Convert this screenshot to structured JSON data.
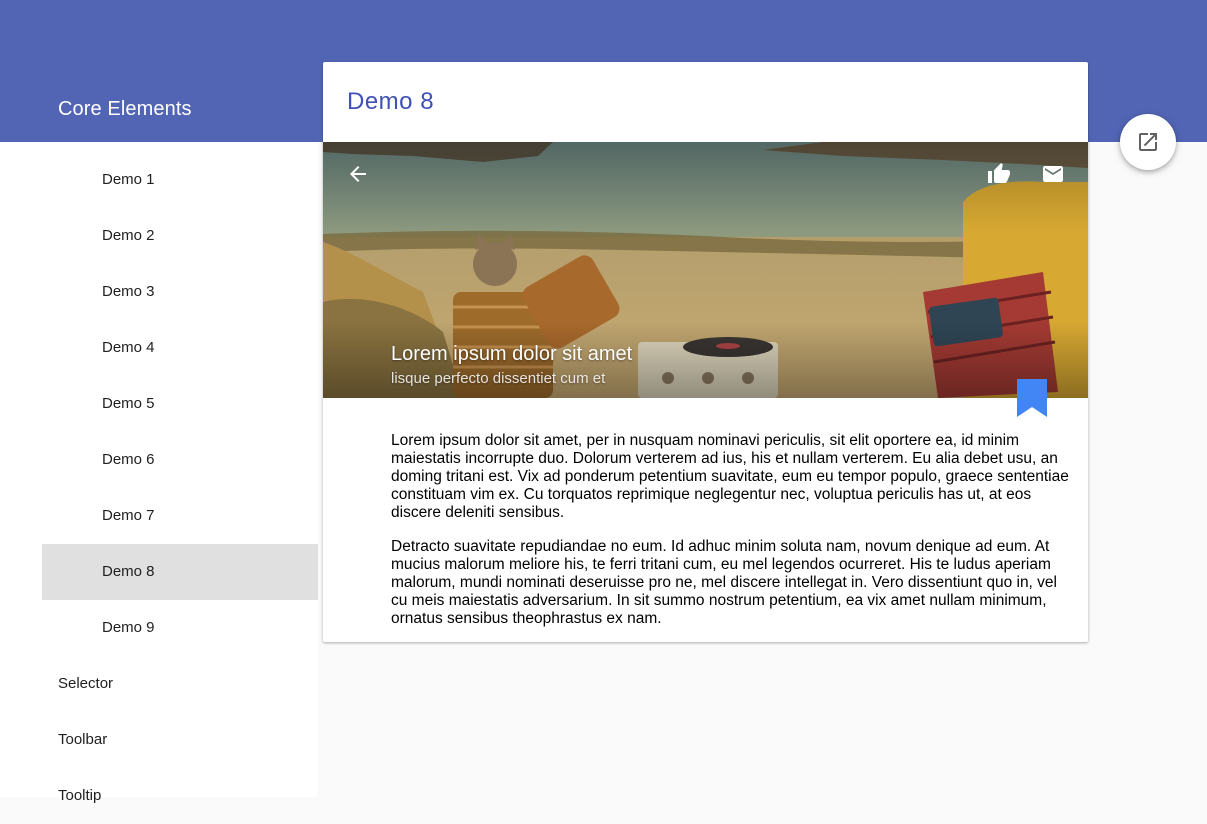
{
  "app": {
    "title": "Core Elements"
  },
  "sidebar": {
    "items": [
      {
        "label": "Demo 1"
      },
      {
        "label": "Demo 2"
      },
      {
        "label": "Demo 3"
      },
      {
        "label": "Demo 4"
      },
      {
        "label": "Demo 5"
      },
      {
        "label": "Demo 6"
      },
      {
        "label": "Demo 7"
      },
      {
        "label": "Demo 8",
        "selected": true
      },
      {
        "label": "Demo 9"
      },
      {
        "label": "Selector"
      },
      {
        "label": "Toolbar"
      },
      {
        "label": "Tooltip"
      }
    ]
  },
  "card": {
    "title": "Demo 8",
    "hero": {
      "heading": "Lorem ipsum dolor sit amet",
      "subheading": "lisque perfecto dissentiet cum et"
    },
    "paragraphs": [
      "Lorem ipsum dolor sit amet, per in nusquam nominavi periculis, sit elit oportere ea, id minim maiestatis incorrupte duo. Dolorum verterem ad ius, his et nullam verterem. Eu alia debet usu, an doming tritani est. Vix ad ponderum petentium suavitate, eum eu tempor populo, graece sententiae constituam vim ex. Cu torquatos reprimique neglegentur nec, voluptua periculis has ut, at eos discere deleniti sensibus.",
      "Detracto suavitate repudiandae no eum. Id adhuc minim soluta nam, novum denique ad eum. At mucius malorum meliore his, te ferri tritani cum, eu mel legendos ocurreret. His te ludus aperiam malorum, mundi nominati deseruisse pro ne, mel discere intellegat in. Vero dissentiunt quo in, vel cu meis maiestatis adversarium. In sit summo nostrum petentium, ea vix amet nullam minimum, ornatus sensibus theophrastus ex nam."
    ]
  },
  "icons": {
    "back": "arrow-back-icon",
    "like": "thumb-up-icon",
    "mail": "mail-icon",
    "bookmark": "bookmark-icon",
    "fab": "open-in-new-icon"
  },
  "colors": {
    "header": "#5265b5",
    "title_accent": "#3f51b5",
    "bookmark": "#4285f4",
    "selected_nav": "#e0e0e0"
  }
}
